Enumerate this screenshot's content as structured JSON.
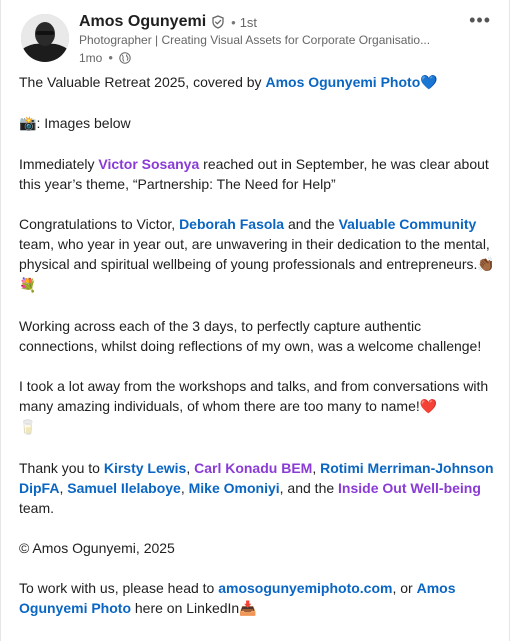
{
  "post": {
    "author": {
      "name": "Amos Ogunyemi",
      "degree_sep": "•",
      "degree": "1st",
      "headline": "Photographer | Creating Visual Assets for Corporate Organisatio...",
      "time": "1mo",
      "more_icon": "•••"
    },
    "p1": {
      "t1": "The Valuable Retreat 2025, covered by ",
      "l1": "Amos Ogunyemi Photo",
      "e1": "💙"
    },
    "p2": {
      "e1": "📸",
      "t1": ": Images below"
    },
    "p3": {
      "t1": "Immediately ",
      "l1": "Victor Sosanya",
      "t2": " reached out in September, he was clear about this year’s theme, “Partnership: The Need for Help”"
    },
    "p4": {
      "t1": "Congratulations to Victor, ",
      "l1": "Deborah Fasola",
      "t2": " and the ",
      "l2": "Valuable Community",
      "t3": " team, who year in year out, are unwavering in their dedication to the mental, physical and spiritual wellbeing of young professionals and entrepreneurs.",
      "e1": "👏🏾💐"
    },
    "p5": {
      "t1": "Working across each of the 3 days, to perfectly capture authentic connections, whilst doing reflections of my own, was a welcome challenge!"
    },
    "p6": {
      "t1": "I took a lot away from the workshops and talks, and from conversations with many amazing individuals, of whom there are too many to name!",
      "e1": "❤️",
      "e2": "🥛"
    },
    "p7": {
      "t1": "Thank you to ",
      "l1": "Kirsty Lewis",
      "t2": ", ",
      "l2": "Carl Konadu BEM",
      "t3": ", ",
      "l3": "Rotimi Merriman-Johnson DipFA",
      "t4": ", ",
      "l4": "Samuel Ilelaboye",
      "t5": ", ",
      "l5": "Mike Omoniyi",
      "t6": ", and the ",
      "l6": "Inside Out Well-being",
      "t7": " team."
    },
    "p8": {
      "t1": "© Amos Ogunyemi, 2025"
    },
    "p9": {
      "t1": "To work with us, please head to ",
      "l1": "amosogunyemiphoto.com",
      "t2": ", or ",
      "l2": "Amos Ogunyemi Photo",
      "t3": " here on LinkedIn",
      "e1": "📥"
    }
  },
  "icons": {
    "verified": "shield-check-icon",
    "globe": "globe-icon",
    "more": "more-horizontal-icon"
  },
  "colors": {
    "link_blue": "#0a66c2",
    "link_purple": "#8a3bd6",
    "text": "#1f1f1f",
    "muted": "#666666"
  }
}
